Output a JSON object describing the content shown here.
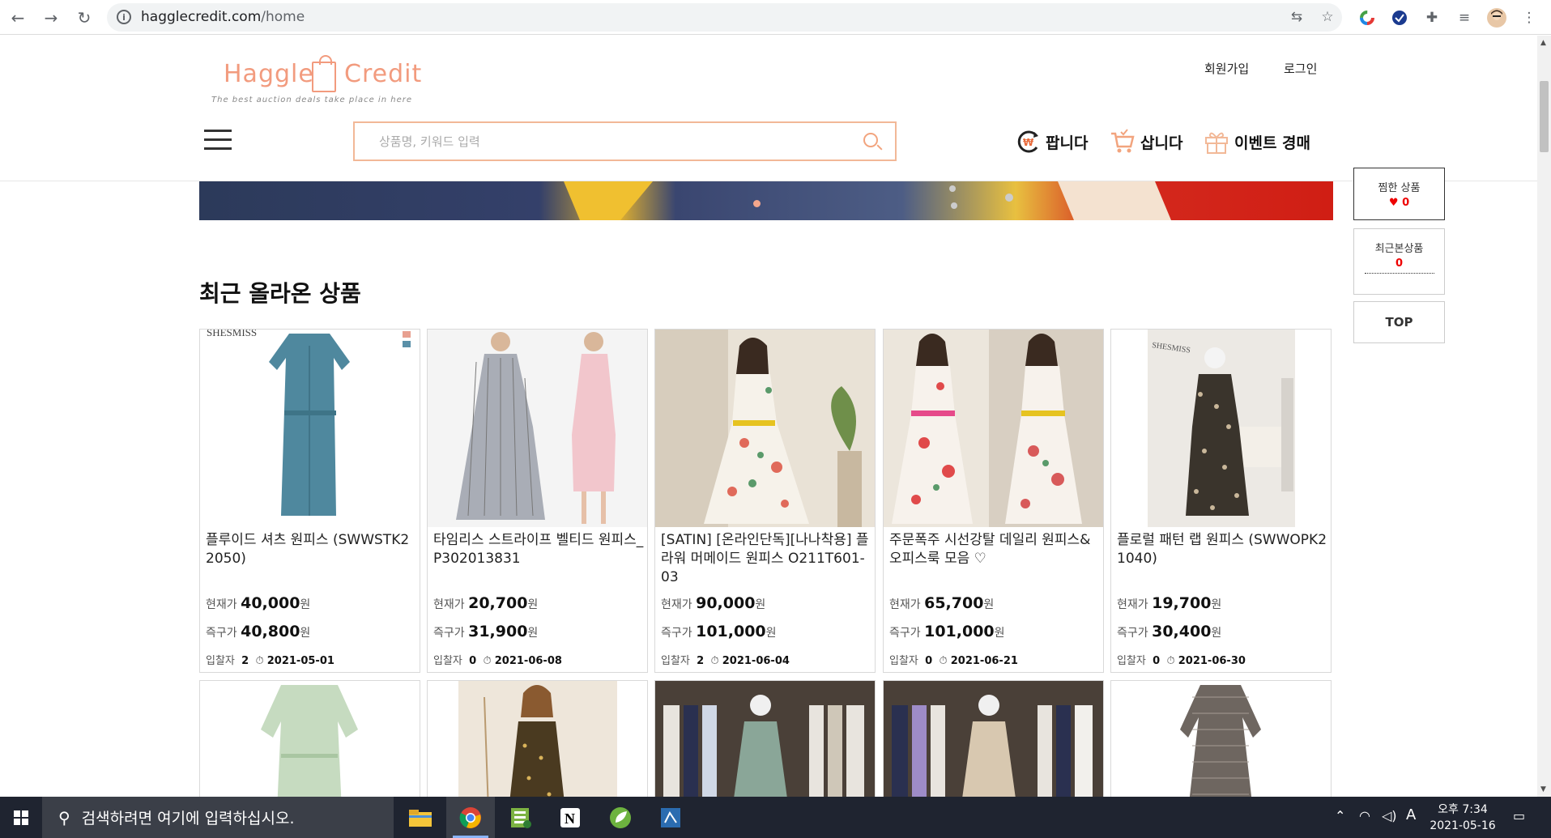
{
  "browser": {
    "url_domain": "hagglecredit.com",
    "url_path": "/home"
  },
  "header": {
    "logo_left": "Haggle",
    "logo_right": "Credit",
    "logo_tagline": "The best auction deals take place in here",
    "signup": "회원가입",
    "login": "로그인",
    "search_placeholder": "상품명, 키워드 입력",
    "menu": [
      {
        "label": "팝니다",
        "icon": "sell-icon"
      },
      {
        "label": "삽니다",
        "icon": "cart-icon"
      },
      {
        "label": "이벤트 경매",
        "icon": "gift-icon"
      }
    ]
  },
  "side": {
    "liked_label": "찜한 상품",
    "liked_count": "0",
    "liked_heart": "♥",
    "recent_label": "최근본상품",
    "recent_count": "0",
    "top_label": "TOP"
  },
  "section_title": "최근 올라온 상품",
  "labels": {
    "current_price": "현재가",
    "buy_now": "즉구가",
    "won": "원",
    "bidders": "입찰자"
  },
  "products": [
    {
      "name": "플루이드 셔츠 원피스 (SWWSTK22050)",
      "current": "40,000",
      "buynow": "40,800",
      "bids": "2",
      "date": "2021-05-01"
    },
    {
      "name": "타임리스 스트라이프 벨티드 원피스_P302013831",
      "current": "20,700",
      "buynow": "31,900",
      "bids": "0",
      "date": "2021-06-08"
    },
    {
      "name": "[SATIN] [온라인단독][나나착용] 플라워 머메이드 원피스 O211T601-03",
      "current": "90,000",
      "buynow": "101,000",
      "bids": "2",
      "date": "2021-06-04"
    },
    {
      "name": "주문폭주 시선강탈 데일리 원피스&오피스룩 모음 ♡",
      "current": "65,700",
      "buynow": "101,000",
      "bids": "0",
      "date": "2021-06-21"
    },
    {
      "name": "플로럴 패턴 랩 원피스 (SWWOPK21040)",
      "current": "19,700",
      "buynow": "30,400",
      "bids": "0",
      "date": "2021-06-30"
    }
  ],
  "taskbar": {
    "search_text": "검색하려면 여기에 입력하십시오.",
    "time": "오후 7:34",
    "date": "2021-05-16",
    "ime": "A"
  }
}
